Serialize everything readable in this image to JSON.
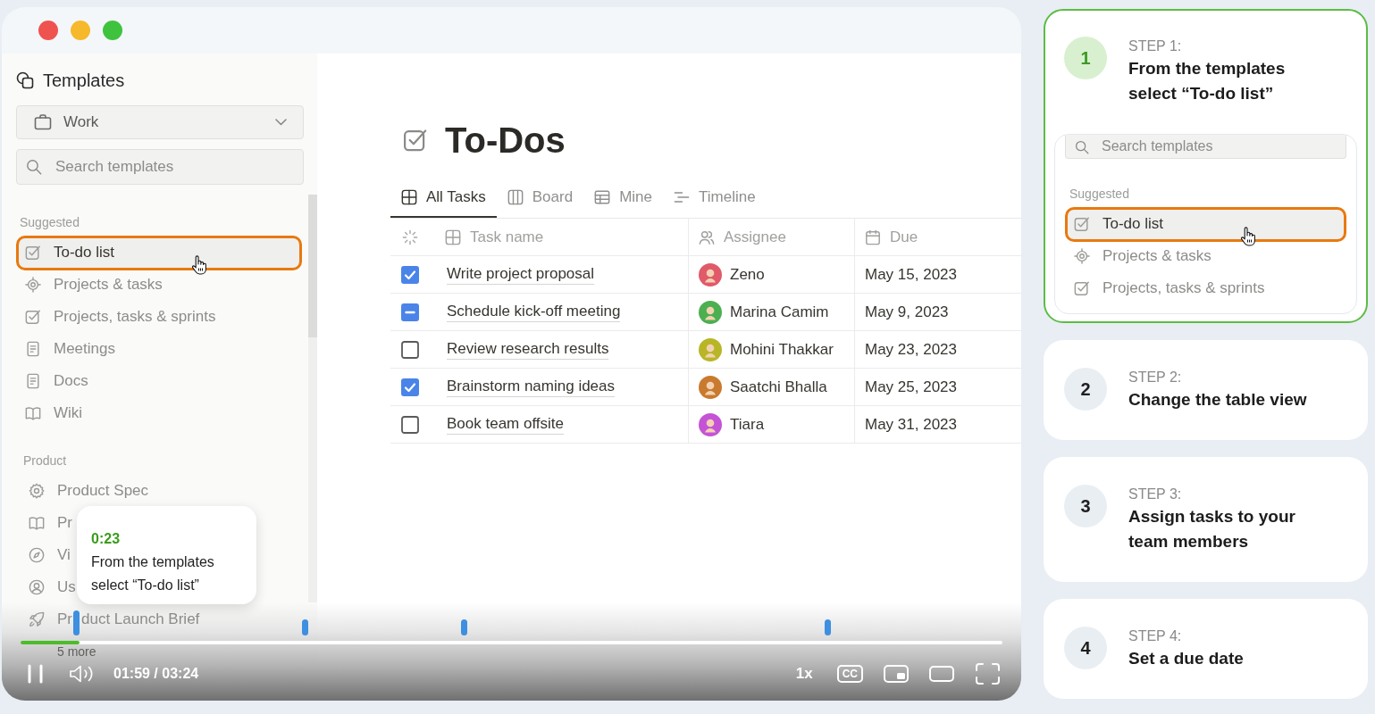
{
  "sidebar": {
    "title": "Templates",
    "workspace": "Work",
    "search": {
      "placeholder": "Search templates"
    },
    "sections": [
      {
        "heading": "Suggested",
        "items": [
          {
            "label": "To-do list",
            "selected": true
          },
          {
            "label": "Projects & tasks",
            "selected": false
          },
          {
            "label": "Projects, tasks & sprints",
            "selected": false
          },
          {
            "label": "Meetings",
            "selected": false
          },
          {
            "label": "Docs",
            "selected": false
          },
          {
            "label": "Wiki",
            "selected": false
          }
        ]
      },
      {
        "heading": "Product",
        "items": [
          {
            "label": "Product Spec",
            "selected": false
          },
          {
            "label": "Pr",
            "selected": false
          },
          {
            "label": "Vi",
            "selected": false
          },
          {
            "label": "Us",
            "selected": false
          },
          {
            "label_parts": [
              "Pr",
              "duct Launch Brief"
            ],
            "selected": false
          }
        ],
        "more": "5 more"
      }
    ]
  },
  "main": {
    "title": "To-Dos",
    "tabs": [
      {
        "label": "All Tasks",
        "selected": true
      },
      {
        "label": "Board",
        "selected": false
      },
      {
        "label": "Mine",
        "selected": false
      },
      {
        "label": "Timeline",
        "selected": false
      }
    ],
    "table": {
      "columns": [
        "Task name",
        "Assignee",
        "Due"
      ],
      "rows": [
        {
          "checked": true,
          "indeterminate": false,
          "task": "Write project proposal",
          "assignee": "Zeno",
          "color": "#e05a6a",
          "due": "May 15, 2023"
        },
        {
          "checked": true,
          "indeterminate": true,
          "task": "Schedule kick-off meeting",
          "assignee": "Marina Camim",
          "color": "#4caf50",
          "due": "May 9, 2023"
        },
        {
          "checked": false,
          "indeterminate": false,
          "task": "Review research results",
          "assignee": "Mohini Thakkar",
          "color": "#b8b626",
          "due": "May 23, 2023"
        },
        {
          "checked": true,
          "indeterminate": false,
          "task": "Brainstorm naming ideas",
          "assignee": "Saatchi Bhalla",
          "color": "#c97a2e",
          "due": "May 25, 2023"
        },
        {
          "checked": false,
          "indeterminate": false,
          "task": "Book team offsite",
          "assignee": "Tiara",
          "color": "#c553d6",
          "due": "May 31, 2023"
        }
      ]
    }
  },
  "player": {
    "playing": true,
    "progress": {
      "level": 0.06
    },
    "chapters": [
      {
        "hovered": true,
        "tooltip": {
          "time": "0:23",
          "text": "From the templates select “To-do list”"
        }
      },
      {
        "hovered": false
      },
      {
        "hovered": false
      },
      {
        "hovered": false
      }
    ],
    "time": "01:59 / 03:24",
    "speed": "1x",
    "captions": "CC"
  },
  "steps": [
    {
      "number": "1",
      "label": "STEP 1:",
      "title": "From the templates select “To-do list”",
      "selected": true,
      "preview": {
        "search": {
          "placeholder": "Search templates"
        },
        "heading": "Suggested",
        "items": [
          {
            "label": "To-do list",
            "selected": true
          },
          {
            "label": "Projects & tasks",
            "selected": false
          },
          {
            "label": "Projects, tasks & sprints",
            "selected": false
          }
        ]
      }
    },
    {
      "number": "2",
      "label": "STEP 2:",
      "title": "Change the table view",
      "selected": false
    },
    {
      "number": "3",
      "label": "STEP 3:",
      "title": "Assign tasks to your team members",
      "selected": false
    },
    {
      "number": "4",
      "label": "STEP 4:",
      "title": "Set a due date",
      "selected": false
    }
  ]
}
